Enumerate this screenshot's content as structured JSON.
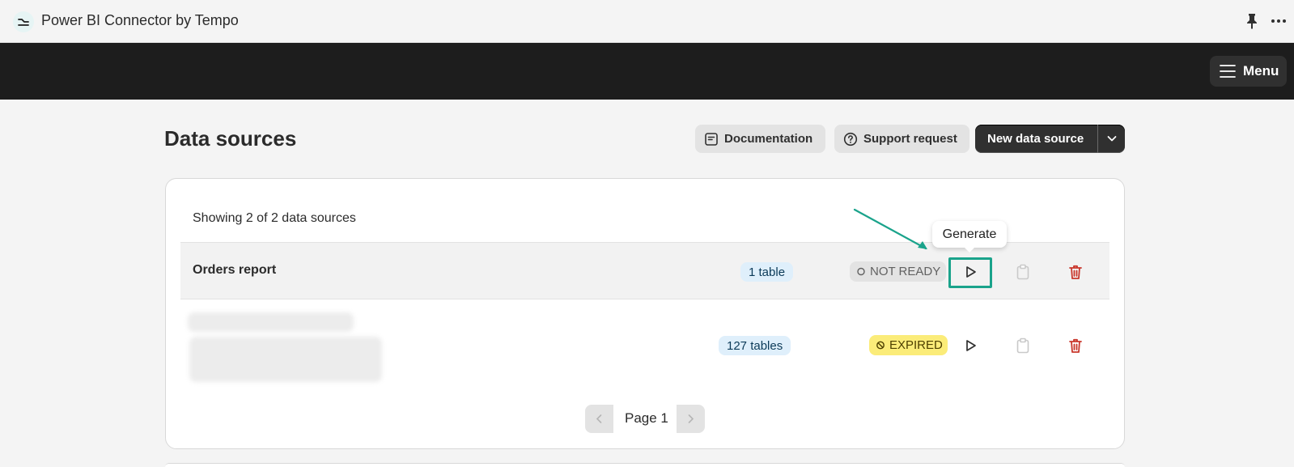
{
  "app": {
    "title": "Power BI Connector by Tempo"
  },
  "navbar": {
    "menu_label": "Menu"
  },
  "page": {
    "title": "Data sources",
    "documentation_label": "Documentation",
    "support_label": "Support request",
    "new_source_label": "New data source"
  },
  "list": {
    "showing_text": "Showing 2 of 2 data sources",
    "rows": [
      {
        "name": "Orders report",
        "tables": "1 table",
        "status": "NOT READY",
        "status_color": "#e3e3e3"
      },
      {
        "name": "",
        "tables": "127 tables",
        "status": "EXPIRED",
        "status_color": "#fbec79"
      }
    ],
    "tooltip": "Generate"
  },
  "pagination": {
    "label": "Page 1"
  },
  "colors": {
    "accent_highlight": "#1aa38b",
    "delete_red": "#c9372c",
    "navbar_bg": "#1d1d1d"
  }
}
